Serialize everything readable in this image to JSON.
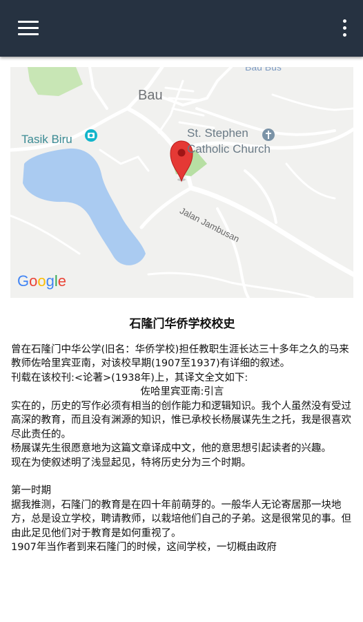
{
  "appbar": {
    "menu_icon": "hamburger-menu-icon",
    "overflow_icon": "more-vert-icon",
    "background": "#263241"
  },
  "map": {
    "labels": {
      "bau": "Bau",
      "tasik_biru": "Tasik Biru",
      "church_line1": "St. Stephen",
      "church_line2": "Catholic Church",
      "road": "Jalan Jambusan",
      "top_partial": "Bau Bus"
    },
    "google_logo": "Google",
    "marker_icon": "map-pin-icon",
    "lake_color": "#aacbf1",
    "marker_color": "#e53935"
  },
  "article": {
    "title": "石隆门华侨学校校史",
    "paragraphs": [
      "曾在石隆门中华公学(旧名：华侨学校)担任教职生涯长达三十多年之久的马来教师佐哈里宾亚南，对该校早期(1907至1937)有详细的叙述。",
      "刊载在该校刊:<论著>(1938年)上，其译文全文如下:",
      "佐哈里宾亚南:引言",
      "实在的，历史的写作必须有相当的创作能力和逻辑知识。我个人虽然没有受过高深的教育，而且没有渊源的知识，惟已承校长杨展谋先生之托，我是很喜欢尽此责任的。",
      "杨展谋先生很愿意地为这篇文章译成中文，他的意思想引起读者的兴趣。",
      "现在为使叙述明了浅显起见，特将历史分为三个时期。",
      "第一时期",
      "据我推测，石隆门的教育是在四十年前萌芽的。一般华人无论寄居那一块地方，总是设立学校，聘请教师，以栽培他们自己的子弟。这是很常见的事。但由此足见他们对于教育是如何重视了。",
      "1907年当作者到来石隆门的时候，这间学校，一切概由政府"
    ]
  }
}
